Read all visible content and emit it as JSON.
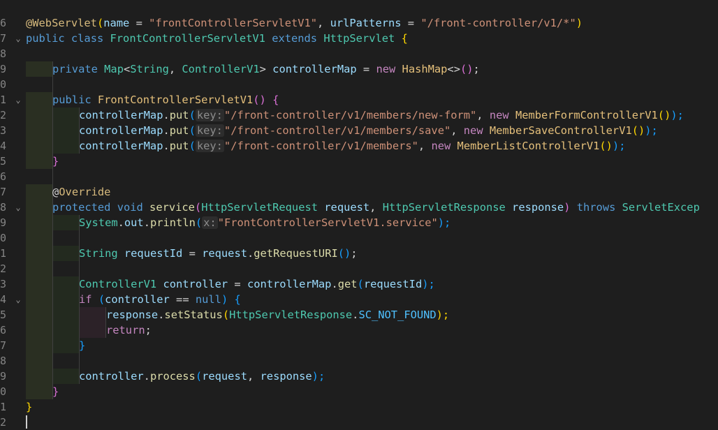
{
  "editor": {
    "line_numbers": [
      "6",
      "7",
      "8",
      "9",
      "0",
      "1",
      "2",
      "3",
      "4",
      "5",
      "6",
      "7",
      "8",
      "9",
      "0",
      "1",
      "2",
      "3",
      "4",
      "5",
      "6",
      "7",
      "8",
      "9",
      "0",
      "1",
      "2"
    ],
    "fold_icon": "chevron-down-icon",
    "lines": {
      "l6_annotation": "@WebServlet",
      "l6_open": "(",
      "l6_name_param": "name",
      "l6_eq1": " = ",
      "l6_name_val": "\"frontControllerServletV1\"",
      "l6_comma": ", ",
      "l6_url_param": "urlPatterns",
      "l6_eq2": " = ",
      "l6_url_val": "\"/front-controller/v1/*\"",
      "l6_close": ")",
      "l7_public": "public",
      "l7_class": "class",
      "l7_name": "FrontControllerServletV1",
      "l7_extends": "extends",
      "l7_parent": "HttpServlet",
      "l7_brace": "{",
      "l9_private": "private",
      "l9_map": "Map",
      "l9_lt": "<",
      "l9_string": "String",
      "l9_comma": ", ",
      "l9_cv1": "ControllerV1",
      "l9_gt": ">",
      "l9_var": "controllerMap",
      "l9_eq": " = ",
      "l9_new": "new",
      "l9_hashmap": "HashMap",
      "l9_diamond": "<>",
      "l9_parens": "()",
      "l9_semi": ";",
      "l11_public": "public",
      "l11_ctor": "FrontControllerServletV1",
      "l11_parens": "()",
      "l11_brace": "{",
      "put_obj": "controllerMap",
      "put_dot": ".",
      "put_fn": "put",
      "put_open": "(",
      "put_hint": "key:",
      "l12_key": "\"/front-controller/v1/members/new-form\"",
      "l12_comma": ", ",
      "l12_new": "new",
      "l12_cls": "MemberFormControllerV1",
      "l12_parens": "()",
      "l12_close": ");",
      "l13_key": "\"/front-controller/v1/members/save\"",
      "l13_comma": ", ",
      "l13_new": "new",
      "l13_cls": "MemberSaveControllerV1",
      "l13_parens": "()",
      "l13_close": ");",
      "l14_key": "\"/front-controller/v1/members\"",
      "l14_comma": ", ",
      "l14_new": "new",
      "l14_cls": "MemberListControllerV1",
      "l14_parens": "()",
      "l14_close": ");",
      "l15_brace": "}",
      "l17_at": "@",
      "l17_override": "Override",
      "l18_protected": "protected",
      "l18_void": "void",
      "l18_service": "service",
      "l18_open": "(",
      "l18_req_type": "HttpServletRequest",
      "l18_req": "request",
      "l18_comma": ", ",
      "l18_resp_type": "HttpServletResponse",
      "l18_resp": "response",
      "l18_close": ")",
      "l18_throws": "throws",
      "l18_exc": "ServletExcep",
      "l19_system": "System",
      "l19_dot1": ".",
      "l19_out": "out",
      "l19_dot2": ".",
      "l19_println": "println",
      "l19_open": "(",
      "l19_hint": "x:",
      "l19_str": "\"FrontControllerServletV1.service\"",
      "l19_close": ");",
      "l21_string": "String",
      "l21_var": "requestId",
      "l21_eq": " = ",
      "l21_obj": "request",
      "l21_dot": ".",
      "l21_fn": "getRequestURI",
      "l21_parens": "()",
      "l21_semi": ";",
      "l23_type": "ControllerV1",
      "l23_var": "controller",
      "l23_eq": " = ",
      "l23_obj": "controllerMap",
      "l23_dot": ".",
      "l23_fn": "get",
      "l23_open": "(",
      "l23_arg": "requestId",
      "l23_close": ");",
      "l24_if": "if",
      "l24_open": "(",
      "l24_var": "controller",
      "l24_eq": " == ",
      "l24_null": "null",
      "l24_close": ")",
      "l24_brace": "{",
      "l25_obj": "response",
      "l25_dot": ".",
      "l25_fn": "setStatus",
      "l25_open": "(",
      "l25_cls": "HttpServletResponse",
      "l25_dot2": ".",
      "l25_const": "SC_NOT_FOUND",
      "l25_close": ");",
      "l26_return": "return",
      "l26_semi": ";",
      "l27_brace": "}",
      "l29_obj": "controller",
      "l29_dot": ".",
      "l29_fn": "process",
      "l29_open": "(",
      "l29_req": "request",
      "l29_comma": ", ",
      "l29_resp": "response",
      "l29_close": ");",
      "l30_brace": "}",
      "l31_brace": "}"
    }
  }
}
